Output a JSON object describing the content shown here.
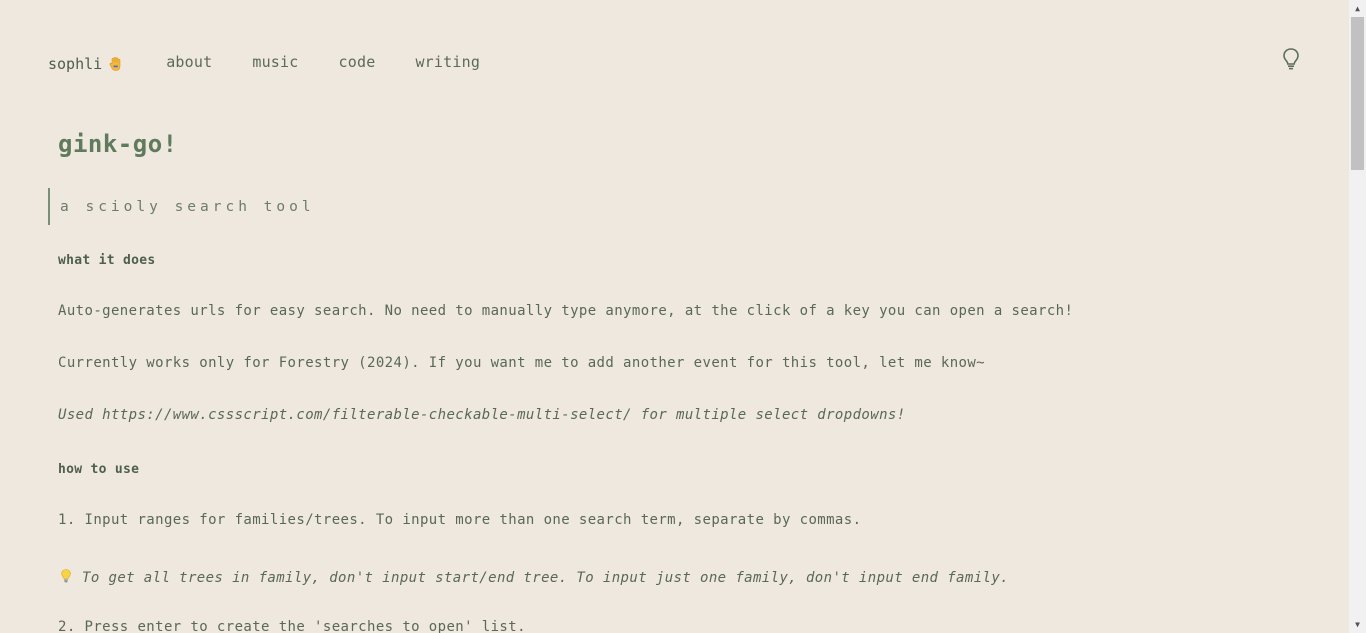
{
  "nav": {
    "brand": "sophli",
    "brand_icon": "raised-hand-emoji",
    "links": [
      "about",
      "music",
      "code",
      "writing"
    ],
    "theme_toggle_icon": "lightbulb-icon"
  },
  "page": {
    "title": "gink-go!",
    "subtitle": "a scioly search tool",
    "what_heading": "what it does",
    "what_p1": "Auto-generates urls for easy search. No need to manually type anymore, at the click of a key you can open a search!",
    "what_p2": "Currently works only for Forestry (2024). If you want me to add another event for this tool, let me know~",
    "what_p3": "Used https://www.cssscript.com/filterable-checkable-multi-select/ for multiple select dropdowns!",
    "how_heading": "how to use",
    "step1": "1. Input ranges for families/trees. To input more than one search term, separate by commas.",
    "tip": "To get all trees in family, don't input start/end tree. To input just one family, don't input end family.",
    "tip_icon": "lightbulb-emoji",
    "step2": "2. Press enter to create the 'searches to open' list."
  },
  "colors": {
    "background": "#efe8df",
    "accent": "#5f7a5c",
    "text": "#5a6858"
  }
}
